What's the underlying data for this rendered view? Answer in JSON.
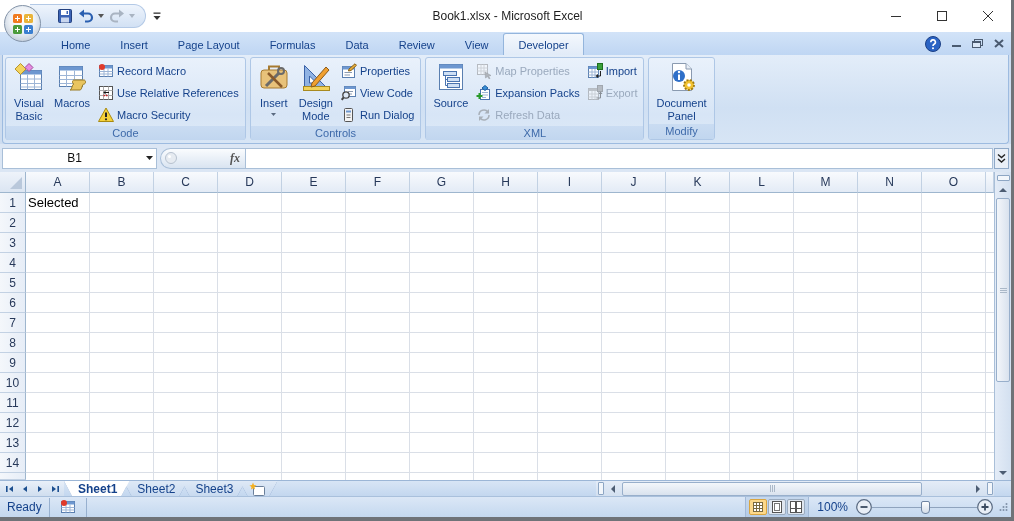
{
  "window": {
    "title": "Book1.xlsx - Microsoft Excel"
  },
  "quick_access": [
    {
      "kind": "save",
      "disabled": false
    },
    {
      "kind": "undo",
      "disabled": false
    },
    {
      "kind": "redo",
      "disabled": true
    }
  ],
  "tabs": [
    {
      "label": "Home",
      "selected": false
    },
    {
      "label": "Insert",
      "selected": false
    },
    {
      "label": "Page Layout",
      "selected": false
    },
    {
      "label": "Formulas",
      "selected": false
    },
    {
      "label": "Data",
      "selected": false
    },
    {
      "label": "Review",
      "selected": false
    },
    {
      "label": "View",
      "selected": false
    },
    {
      "label": "Developer",
      "selected": true
    }
  ],
  "ribbon": {
    "groups": [
      {
        "label": "Code",
        "items": [
          {
            "kind": "large",
            "label": "Visual Basic",
            "disabled": false
          },
          {
            "kind": "large",
            "label": "Macros",
            "disabled": false
          },
          {
            "kind": "small",
            "label": "Record Macro",
            "disabled": false
          },
          {
            "kind": "small",
            "label": "Use Relative References",
            "disabled": false
          },
          {
            "kind": "small",
            "label": "Macro Security",
            "disabled": false
          }
        ]
      },
      {
        "label": "Controls",
        "items": [
          {
            "kind": "menu",
            "label": "Insert",
            "disabled": false
          },
          {
            "kind": "large",
            "label": "Design Mode",
            "disabled": false
          },
          {
            "kind": "small",
            "label": "Properties",
            "disabled": false
          },
          {
            "kind": "small",
            "label": "View Code",
            "disabled": false
          },
          {
            "kind": "small",
            "label": "Run Dialog",
            "disabled": false
          }
        ]
      },
      {
        "label": "XML",
        "items": [
          {
            "kind": "large",
            "label": "Source",
            "disabled": false
          },
          {
            "kind": "small",
            "label": "Map Properties",
            "disabled": true
          },
          {
            "kind": "small",
            "label": "Expansion Packs",
            "disabled": false
          },
          {
            "kind": "small",
            "label": "Refresh Data",
            "disabled": true
          },
          {
            "kind": "small",
            "label": "Import",
            "disabled": false
          },
          {
            "kind": "small",
            "label": "Export",
            "disabled": true
          }
        ]
      },
      {
        "label": "Modify",
        "items": [
          {
            "kind": "large",
            "label": "Document Panel",
            "disabled": false
          }
        ]
      }
    ]
  },
  "formula_bar": {
    "name_box": "B1",
    "function_button": "fx"
  },
  "sheet": {
    "columns": [
      "A",
      "B",
      "C",
      "D",
      "E",
      "F",
      "G",
      "H",
      "I",
      "J",
      "K",
      "L",
      "M",
      "N",
      "O"
    ],
    "rows": [
      {
        "label": "1",
        "values": [
          "Selected"
        ]
      },
      {
        "label": "2"
      },
      {
        "label": "3"
      },
      {
        "label": "4"
      },
      {
        "label": "5"
      },
      {
        "label": "6"
      },
      {
        "label": "7"
      },
      {
        "label": "8"
      },
      {
        "label": "9"
      },
      {
        "label": "10"
      },
      {
        "label": "11"
      },
      {
        "label": "12"
      },
      {
        "label": "13"
      },
      {
        "label": "14"
      }
    ]
  },
  "sheet_tabs": [
    {
      "label": "Sheet1",
      "selected": true
    },
    {
      "label": "Sheet2",
      "selected": false
    },
    {
      "label": "Sheet3",
      "selected": false
    }
  ],
  "status_bar": {
    "text": "Ready",
    "views": [
      {
        "kind": "normal",
        "selected": true
      },
      {
        "kind": "layout",
        "selected": false
      },
      {
        "kind": "pagebreak",
        "selected": false
      }
    ],
    "zoom": "100%",
    "zoom_slider": {
      "level": 0.5
    }
  }
}
